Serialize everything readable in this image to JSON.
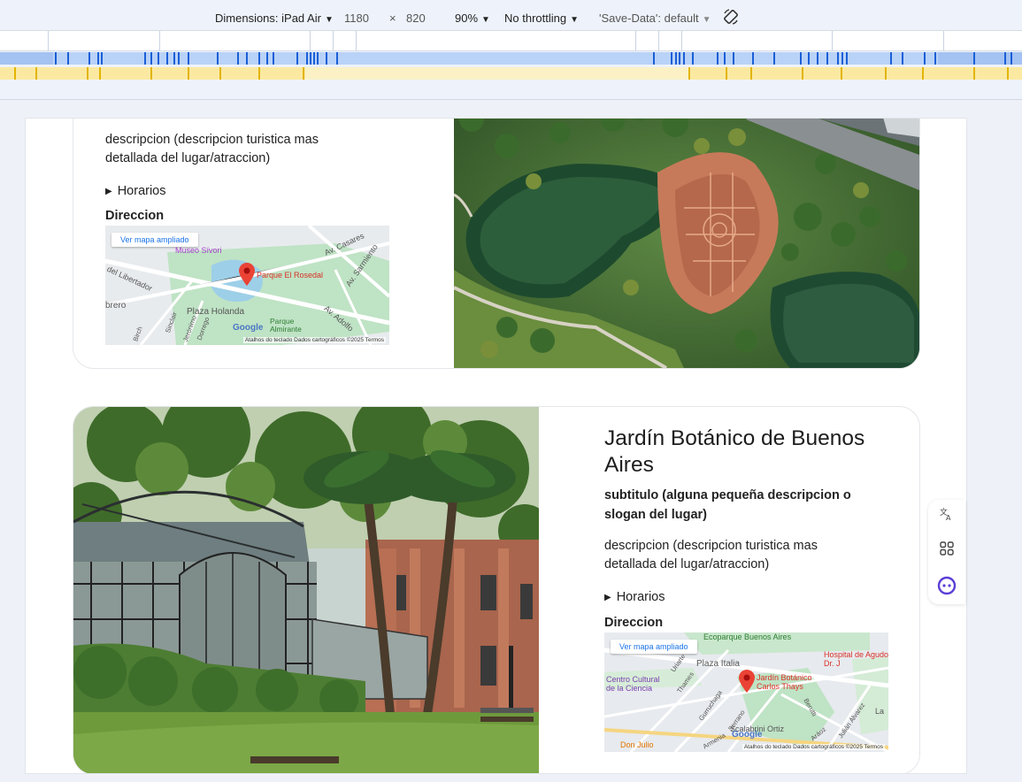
{
  "toolbar": {
    "dimensions_label": "Dimensions: iPad Air",
    "width": "1180",
    "times": "×",
    "height": "820",
    "zoom": "90%",
    "throttling": "No throttling",
    "save_data": "'Save-Data': default"
  },
  "cards": [
    {
      "description": "descripcion (descripcion turistica mas detallada del lugar/atraccion)",
      "hours_label": "Horarios",
      "address_label": "Direccion",
      "map": {
        "button": "Ver mapa ampliado",
        "pin_label": "Parque El Rosedal",
        "labels": [
          "Museo Sívori",
          "Av. Casares",
          "Av. Sarmiento",
          "del Libertador",
          "Plaza Holanda",
          "Parque Almirante",
          "Av. Adolfo",
          "brero",
          "Sinclair",
          "Jerónimo",
          "Dorrego",
          "Birch"
        ],
        "google": "Google",
        "attribution": "Atalhos do teclado   Dados cartográficos ©2025   Termos"
      }
    },
    {
      "title": "Jardín Botánico de Buenos Aires",
      "subtitle": "subtitulo (alguna pequeña descripcion o slogan del lugar)",
      "description": "descripcion (descripcion turistica mas detallada del lugar/atraccion)",
      "hours_label": "Horarios",
      "address_label": "Direccion",
      "map": {
        "button": "Ver mapa ampliado",
        "pin_label": "Jardín Botánico Carlos Thays",
        "labels": [
          "Ecoparque Buenos Aires",
          "Plaza Italia",
          "Centro Cultural de la Ciencia",
          "Hospital de Agudos Dr. J",
          "Uriarte",
          "Thames",
          "Gurruchaga",
          "Serrano",
          "Berutti",
          "Julián Álvarez",
          "Armenia",
          "Scalabrini Ortiz",
          "Don Julio",
          "Aráoz",
          "La"
        ],
        "google": "Google",
        "attribution": "Atalhos do teclado   Dados cartográficos ©2025   Termos"
      }
    }
  ],
  "side_icons": [
    "translate-icon",
    "apps-icon",
    "assistant-icon"
  ]
}
